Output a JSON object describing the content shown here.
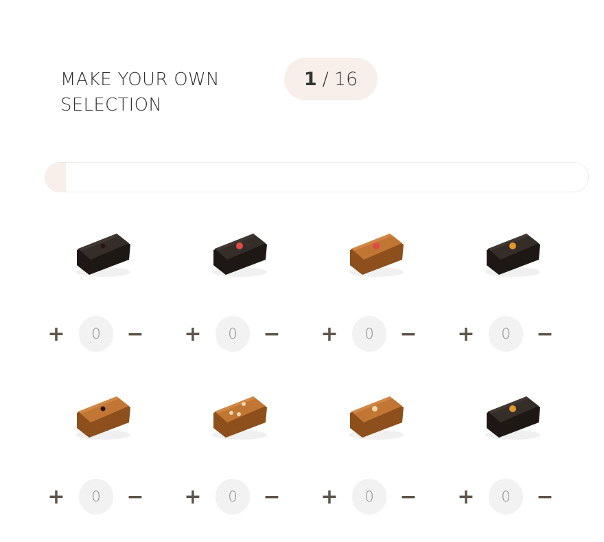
{
  "selection": {
    "title_line1": "MAKE YOUR OWN",
    "title_line2": "SELECTION",
    "count_current": "1",
    "count_separator": "/",
    "count_total": "16",
    "progress_fraction": 0.0375
  },
  "colors": {
    "accent_bg": "#f8efea",
    "control": "#5e544a",
    "dark_chocolate": "#2e2723",
    "milk_chocolate": "#b06a2f"
  },
  "controls": {
    "plus_label": "+",
    "minus_label": "−"
  },
  "products": [
    {
      "coating": "dark",
      "topping": "dark-dot",
      "quantity": "0"
    },
    {
      "coating": "dark",
      "topping": "red-dot",
      "quantity": "0"
    },
    {
      "coating": "milk",
      "topping": "red-dot",
      "quantity": "0"
    },
    {
      "coating": "dark",
      "topping": "orange-dot",
      "quantity": "0"
    },
    {
      "coating": "milk",
      "topping": "dark-dot",
      "quantity": "0"
    },
    {
      "coating": "milk",
      "topping": "three-dots",
      "quantity": "0"
    },
    {
      "coating": "milk",
      "topping": "cream-dot",
      "quantity": "0"
    },
    {
      "coating": "dark",
      "topping": "orange-dot",
      "quantity": "0"
    }
  ]
}
